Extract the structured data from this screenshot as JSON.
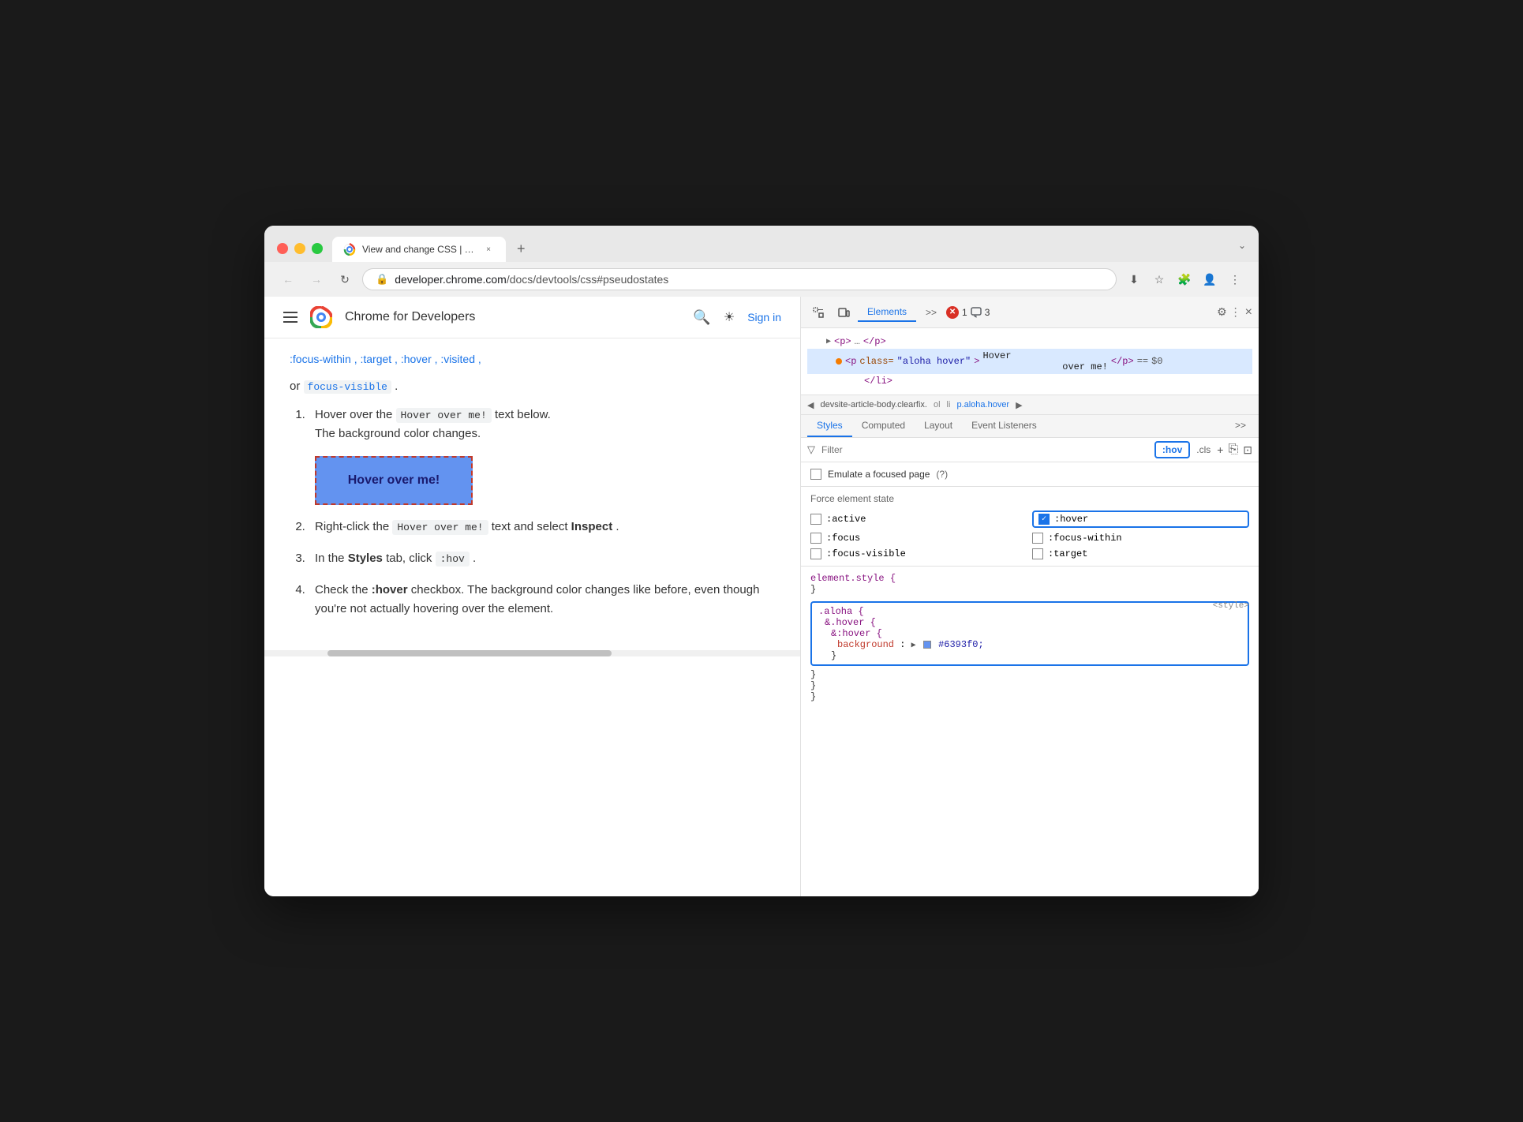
{
  "browser": {
    "tab": {
      "favicon": "chrome",
      "title": "View and change CSS | Chr",
      "close_label": "×"
    },
    "new_tab_label": "+",
    "chevron_label": "⌄",
    "nav": {
      "back_label": "←",
      "forward_label": "→",
      "reload_label": "↻"
    },
    "address": {
      "domain": "developer.chrome.com",
      "path": "/docs/devtools/css#pseudostates"
    },
    "toolbar_actions": {
      "download_label": "⬇",
      "bookmark_label": "☆",
      "extensions_label": "🧩",
      "profile_label": "👤",
      "menu_label": "⋮"
    }
  },
  "page": {
    "header": {
      "site_name": "Chrome for Developers",
      "search_icon": "search",
      "theme_icon": "☀",
      "signin_label": "Sign in"
    },
    "article": {
      "intro_links": ":focus-within , :target , :hover , :visited ,",
      "focus_visible": "focus-visible",
      "period": ".",
      "list_items": [
        {
          "number": 1,
          "text_before": "Hover over the",
          "code": "Hover over me!",
          "text_after": "text below. The background color changes."
        },
        {
          "number": 2,
          "text_before": "Right-click the",
          "code": "Hover over me!",
          "text_after": "text and select",
          "bold_word": "Inspect",
          "period": "."
        },
        {
          "number": 3,
          "text_before": "In the",
          "bold_word": "Styles",
          "text_middle": "tab, click",
          "code_hov": ":hov",
          "period": "."
        },
        {
          "number": 4,
          "text_before": "Check the",
          "bold_word": ":hover",
          "text_after": "checkbox. The background color changes like before, even though you're not actually hovering over the element."
        }
      ],
      "hover_button_label": "Hover over me!"
    }
  },
  "devtools": {
    "header": {
      "tabs": [
        "Elements",
        ">>"
      ],
      "active_tab": "Elements",
      "error_count": "1",
      "warning_count": "3",
      "settings_icon": "⚙",
      "menu_icon": "⋮",
      "close_icon": "×"
    },
    "dom": {
      "lines": [
        {
          "indent": 1,
          "html": "▶ <p>…</p>"
        },
        {
          "indent": 2,
          "html": "<p class=\"aloha hover\">Hover over me!</p> == $0",
          "selected": true,
          "dot": true
        },
        {
          "indent": 2,
          "html": "</li>"
        }
      ]
    },
    "breadcrumb": {
      "back": "◀",
      "forward": "▶",
      "items": [
        "devsite-article-body.clearfix.",
        "ol",
        "li",
        "p.aloha.hover"
      ],
      "active": "p.aloha.hover"
    },
    "styles": {
      "tabs": [
        "Styles",
        "Computed",
        "Layout",
        "Event Listeners",
        ">>"
      ],
      "active_tab": "Styles"
    },
    "filter": {
      "icon": "▽",
      "placeholder": "Filter",
      "hov_label": ":hov",
      "cls_label": ".cls",
      "add_icon": "+",
      "copy_icon": "⎘",
      "layout_icon": "⊡"
    },
    "emulate": {
      "label": "Emulate a focused page",
      "help_icon": "?"
    },
    "force_state": {
      "title": "Force element state",
      "states": [
        {
          "id": "active",
          "label": ":active",
          "checked": false
        },
        {
          "id": "hover",
          "label": ":hover",
          "checked": true
        },
        {
          "id": "focus",
          "label": ":focus",
          "checked": false
        },
        {
          "id": "focus-within",
          "label": ":focus-within",
          "checked": false
        },
        {
          "id": "focus-visible",
          "label": ":focus-visible",
          "checked": false
        },
        {
          "id": "target",
          "label": ":target",
          "checked": false
        }
      ]
    },
    "css_rules": {
      "element_style": {
        "selector": "element.style {",
        "close": "}"
      },
      "aloha_rule": {
        "selector": ".aloha {",
        "hover_selector": "&.hover {",
        "hover_pseudo": "&:hover {",
        "property": "background",
        "colon": ":",
        "value": "#6393f0",
        "close_inner": "}",
        "close_outer": "}",
        "close_root": "}",
        "source": "<style>",
        "extra_close": "}"
      }
    }
  }
}
